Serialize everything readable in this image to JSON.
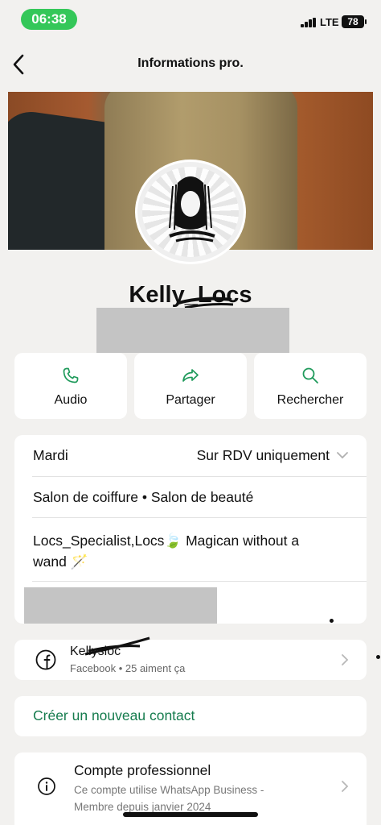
{
  "status_bar": {
    "time": "06:38",
    "network": "LTE",
    "battery": "78"
  },
  "nav": {
    "title": "Informations pro."
  },
  "profile": {
    "name": "Kelly_Locs"
  },
  "actions": [
    {
      "label": "Audio",
      "icon": "phone-icon"
    },
    {
      "label": "Partager",
      "icon": "share-icon"
    },
    {
      "label": "Rechercher",
      "icon": "search-icon"
    }
  ],
  "info": {
    "hours_day": "Mardi",
    "hours_value": "Sur RDV uniquement",
    "categories": "Salon de coiffure • Salon de beauté",
    "description_line1": "Locs_Specialist,Locs🍃 Magican without a",
    "description_line2": "wand 🪄"
  },
  "facebook": {
    "title": "Kellysloc",
    "subtitle": "Facebook • 25 aiment ça"
  },
  "new_contact": {
    "label": "Créer un nouveau contact"
  },
  "business": {
    "title": "Compte professionnel",
    "subtitle_line1": "Ce compte utilise WhatsApp Business -",
    "subtitle_line2": "Membre depuis janvier 2024"
  },
  "colors": {
    "accent": "#167c4e",
    "icon_green": "#1f9a5b",
    "status_green": "#34c759",
    "background": "#f2f1ef"
  }
}
